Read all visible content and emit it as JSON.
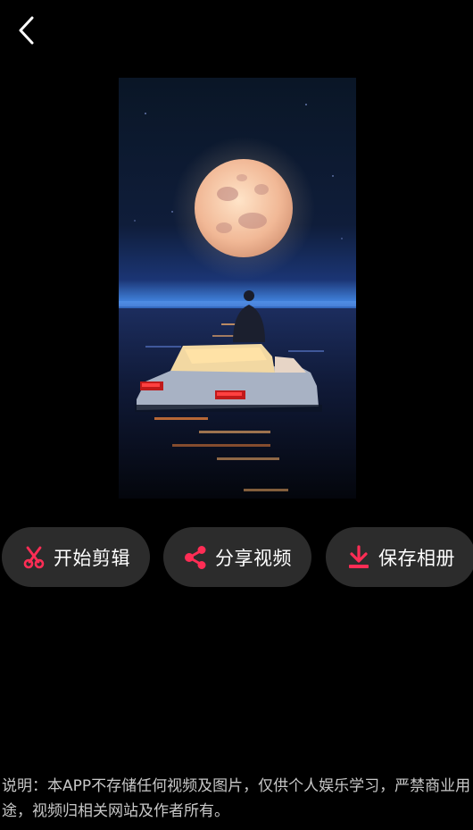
{
  "topbar": {
    "back_icon": "chevron-left-icon"
  },
  "preview": {
    "image_description_icon": "video-thumbnail"
  },
  "actions": {
    "edit": {
      "label": "开始剪辑",
      "icon": "scissors-icon"
    },
    "share": {
      "label": "分享视频",
      "icon": "share-icon"
    },
    "save": {
      "label": "保存相册",
      "icon": "download-icon"
    }
  },
  "footer": {
    "disclaimer": "说明：本APP不存储任何视频及图片，仅供个人娱乐学习，严禁商业用途，视频归相关网站及作者所有。"
  },
  "colors": {
    "background": "#000000",
    "button_bg": "#2c2c2c",
    "accent": "#ff2d55",
    "disclaimer_text": "#c8c8c8"
  }
}
